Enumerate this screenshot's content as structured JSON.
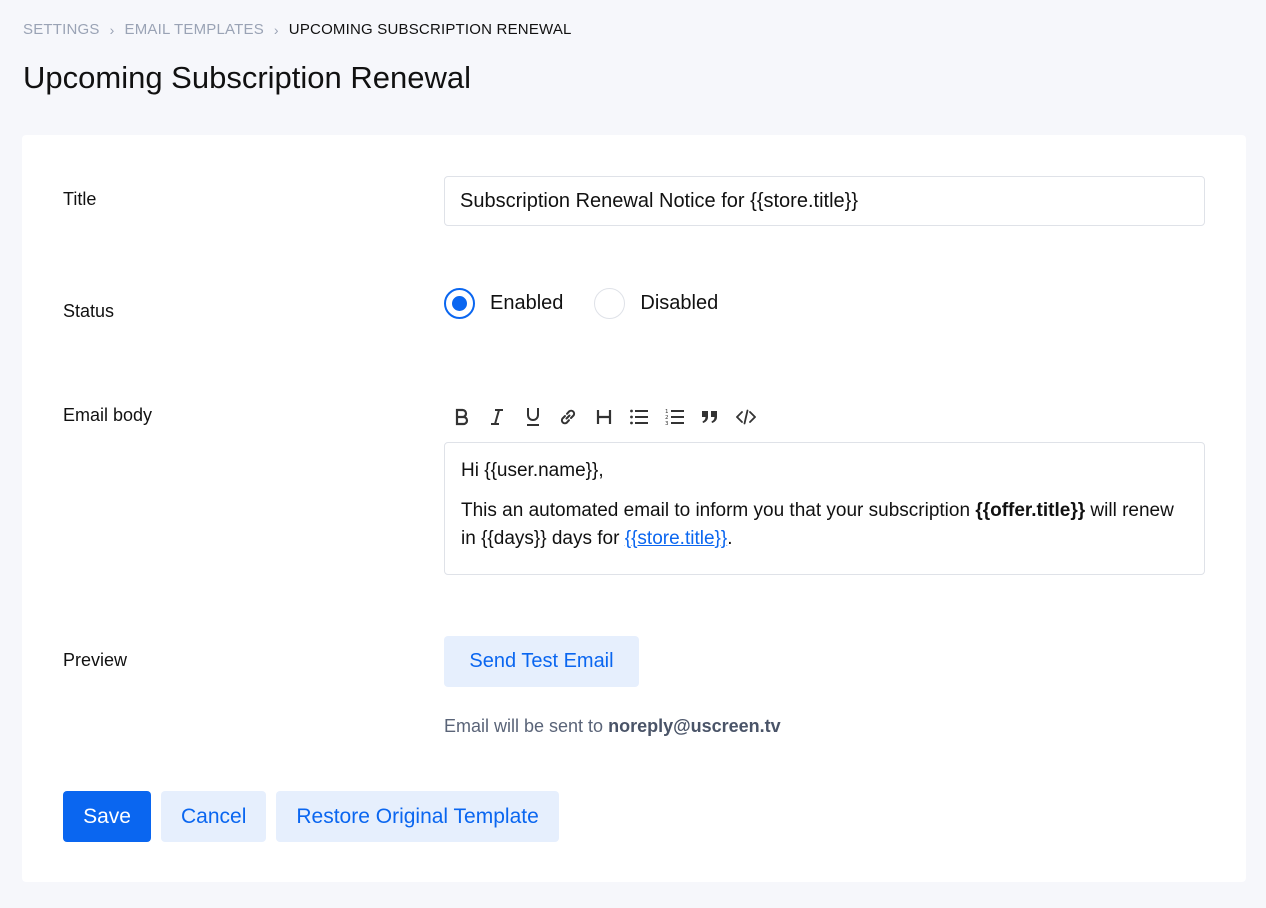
{
  "breadcrumb": {
    "items": [
      "SETTINGS",
      "EMAIL TEMPLATES"
    ],
    "current": "UPCOMING SUBSCRIPTION RENEWAL"
  },
  "page_title": "Upcoming Subscription Renewal",
  "form": {
    "title_label": "Title",
    "title_value": "Subscription Renewal Notice for {{store.title}}",
    "status_label": "Status",
    "status_options": [
      "Enabled",
      "Disabled"
    ],
    "status_selected": "Enabled",
    "body_label": "Email body",
    "toolbar_icons": [
      "bold-icon",
      "italic-icon",
      "underline-icon",
      "link-icon",
      "heading-icon",
      "bullet-list-icon",
      "numbered-list-icon",
      "blockquote-icon",
      "code-icon"
    ],
    "body": {
      "greeting": "Hi {{user.name}},",
      "line_pre": "This an automated email to inform you that your subscription ",
      "line_bold": "{{offer.title}}",
      "line_mid": " will renew in {{days}} days for ",
      "line_link": "{{store.title}}",
      "line_end": "."
    },
    "preview_label": "Preview",
    "send_test_label": "Send Test Email",
    "send_note_prefix": "Email will be sent to ",
    "send_note_email": "noreply@uscreen.tv"
  },
  "actions": {
    "save": "Save",
    "cancel": "Cancel",
    "restore": "Restore Original Template"
  },
  "colors": {
    "accent": "#0a66f0",
    "accent_light": "#e6effd",
    "background": "#f6f7fb"
  }
}
